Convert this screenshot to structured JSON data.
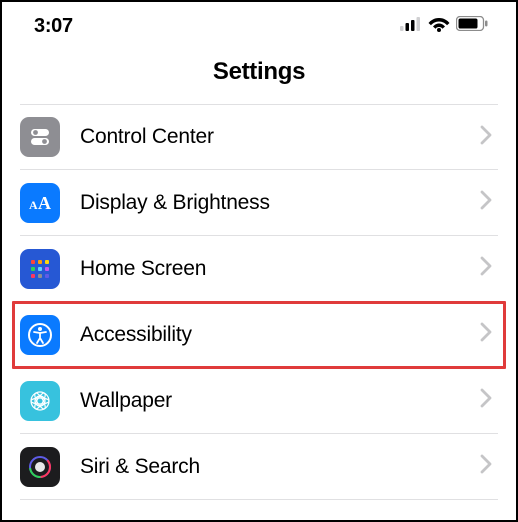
{
  "statusBar": {
    "time": "3:07"
  },
  "header": {
    "title": "Settings"
  },
  "rows": {
    "controlCenter": {
      "label": "Control Center"
    },
    "displayBrightness": {
      "label": "Display & Brightness"
    },
    "homeScreen": {
      "label": "Home Screen"
    },
    "accessibility": {
      "label": "Accessibility"
    },
    "wallpaper": {
      "label": "Wallpaper"
    },
    "siriSearch": {
      "label": "Siri & Search"
    }
  },
  "colors": {
    "highlight": "#e03b3b",
    "iconGray": "#8e8e93",
    "iconBlue": "#0a7aff",
    "iconDarkBlue": "#2658d4",
    "iconCyan": "#37c2de",
    "iconDark": "#1c1c1e"
  }
}
